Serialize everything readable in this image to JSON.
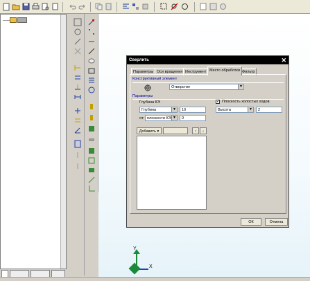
{
  "toolbar": {
    "icons": [
      "new-document-icon",
      "open-folder-icon",
      "save-icon",
      "print-icon",
      "print-preview-icon",
      "cut-icon",
      "undo-icon",
      "redo-icon",
      "copy-icon",
      "paste-icon",
      "snap-icon",
      "properties-icon",
      "layers-icon",
      "zoom-window-icon",
      "pan-icon",
      "rotate-view-icon",
      "page-icon",
      "view-mode-icon",
      "help-icon"
    ]
  },
  "tree": {
    "tabs": [
      "",
      ""
    ]
  },
  "dialog": {
    "title": "Сверлить",
    "close": "✕",
    "tabs": [
      "Параметры",
      "Оси вращения",
      "Инструмент",
      "Место обработки",
      "Фильтр"
    ],
    "active_tab": 3,
    "group_element": "Конструктивный элемент",
    "element_value": "Отверстие",
    "group_params": "Параметры",
    "depth_label": "Глубина КЭ",
    "depth_mode": "Глубина",
    "depth_value": "10",
    "from_label": "от:",
    "from_mode": "плоскости КЭ",
    "from_value": "0",
    "idle_plane_label": "Плоскость холостых ходов",
    "idle_plane_checked": true,
    "idle_mode": "Высота",
    "idle_value": "2",
    "add_button": "Добавить",
    "ok_button": "ОК",
    "cancel_button": "Отмена"
  },
  "axes": {
    "y_label": "Y",
    "x_label": "X"
  },
  "colors": {
    "axis_green": "#1a8a3a",
    "axis_blue": "#1f3fbf",
    "dialog_title": "#000000"
  }
}
